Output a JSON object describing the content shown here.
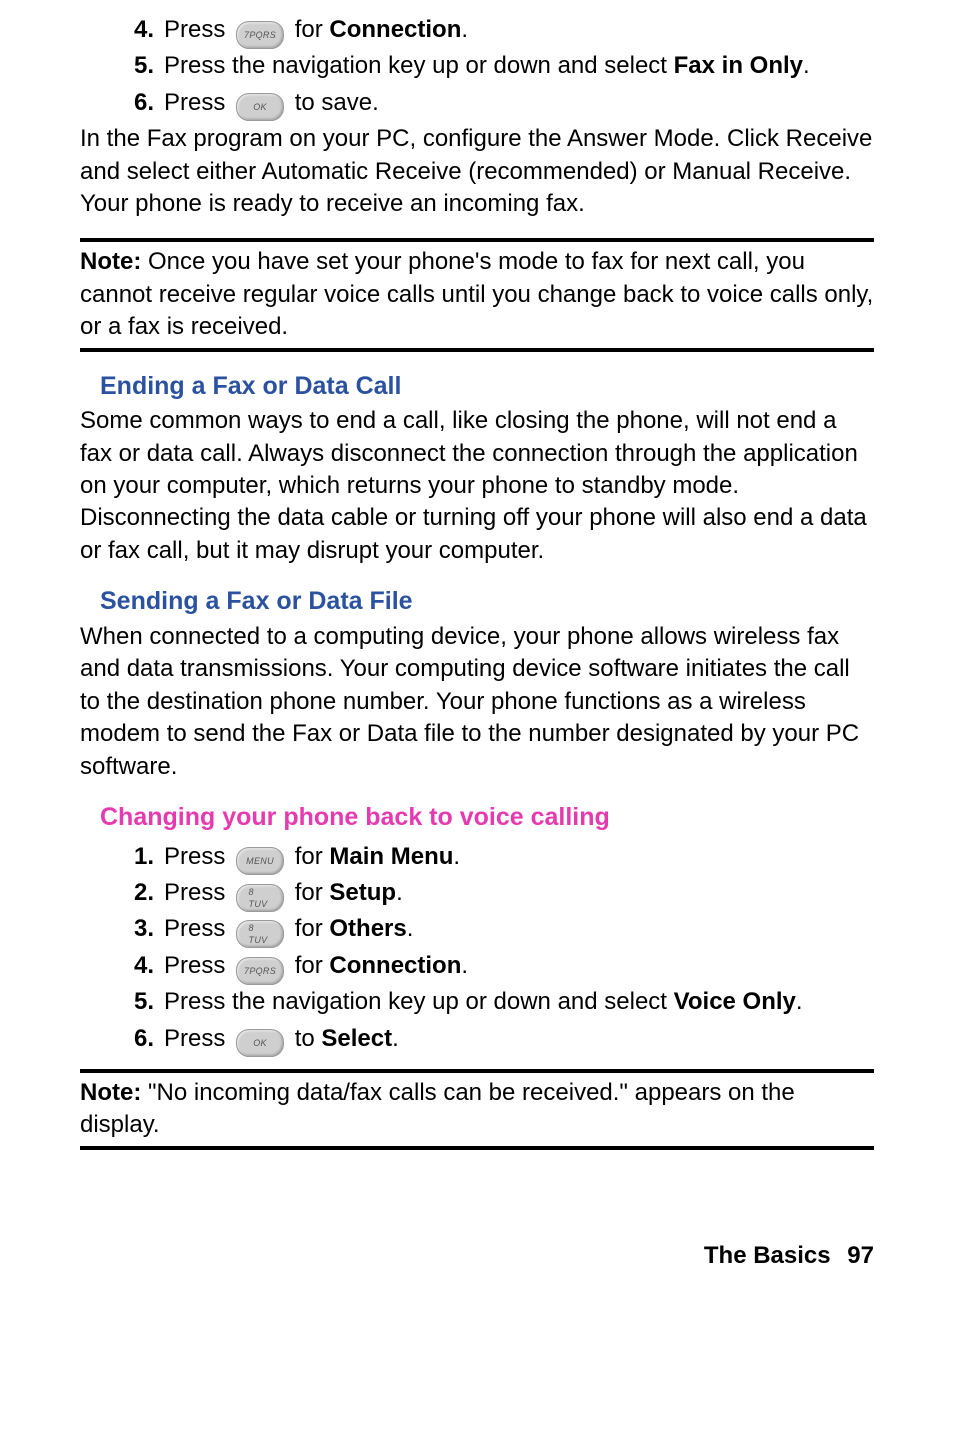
{
  "continued_steps": [
    {
      "num": "4.",
      "pre": "Press",
      "key": "7PQRS",
      "mid": "for",
      "bold": "Connection",
      "post": "."
    },
    {
      "num": "5.",
      "pre": "Press the navigation key up or down and select",
      "bold": "Fax in Only",
      "post": "."
    },
    {
      "num": "6.",
      "pre": "Press",
      "key": "OK",
      "mid": "to save."
    }
  ],
  "fax_intro": {
    "line1_pre": "In the Fax program on your PC, configure the ",
    "line1_em1": "Answer Mode",
    "line1_mid1": ". Click Receive and select either ",
    "line1_em2": "Automatic Receive",
    "line1_mid2": " (recommended) or ",
    "line1_em3": "Manual Receive",
    "line1_post": ". Your phone is ready to receive an incoming fax."
  },
  "note1": {
    "label": "Note:",
    "text": " Once you have set your phone's mode to fax for next call, you cannot receive regular voice calls until you change back to voice calls only, or a fax is received."
  },
  "ending": {
    "heading": "Ending a Fax or Data Call",
    "body": "Some common ways to end a call, like closing the phone, will not end a fax or data call. Always disconnect the connection through the application on your computer, which returns your phone to standby mode. Disconnecting the data cable or turning off your phone will also end a data or fax call, but it may disrupt your computer."
  },
  "sending": {
    "heading": "Sending a Fax or Data File",
    "body": "When connected to a computing device, your phone allows wireless fax and data transmissions. Your computing device software initiates the call to the destination phone number. Your phone functions as a wireless modem to send the Fax or Data file to the number designated by your PC software."
  },
  "changing": {
    "heading": "Changing your phone back to voice calling"
  },
  "voice_steps": [
    {
      "num": "1.",
      "pre": "Press",
      "key": "MENU",
      "mid": "for",
      "bold": "Main Menu",
      "post": "."
    },
    {
      "num": "2.",
      "pre": "Press",
      "key": "8 TUV",
      "mid": "for",
      "bold": "Setup",
      "post": "."
    },
    {
      "num": "3.",
      "pre": "Press",
      "key": "8 TUV",
      "mid": "for",
      "bold": "Others",
      "post": "."
    },
    {
      "num": "4.",
      "pre": "Press",
      "key": "7PQRS",
      "mid": "for",
      "bold": "Connection",
      "post": "."
    },
    {
      "num": "5.",
      "pre": "Press the navigation key up or down and select",
      "bold": "Voice Only",
      "post": "."
    },
    {
      "num": "6.",
      "pre": "Press",
      "key": "OK",
      "mid": "to",
      "bold": "Select",
      "post": "."
    }
  ],
  "note2": {
    "label": "Note:",
    "text": " \"No incoming data/fax calls can be received.\" appears on the display."
  },
  "footer": {
    "section": "The Basics",
    "page": "97"
  }
}
